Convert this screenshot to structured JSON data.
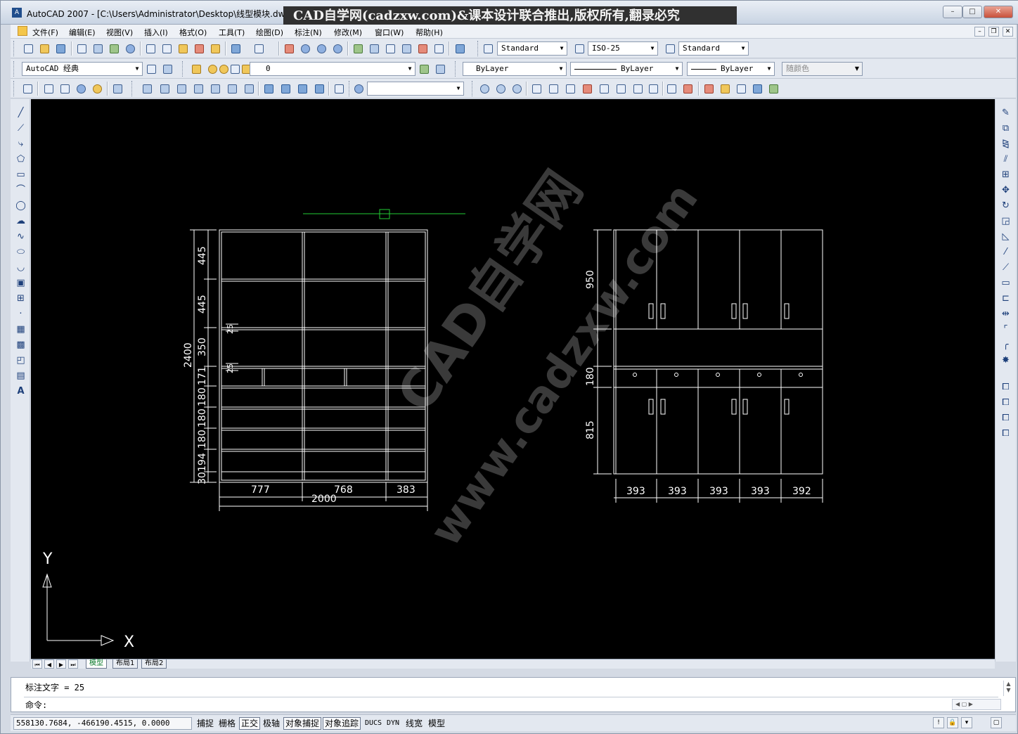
{
  "window": {
    "title": "AutoCAD 2007 - [C:\\Users\\Administrator\\Desktop\\线型模块.dwg]",
    "banner": "CAD自学网(cadzxw.com)&课本设计联合推出,版权所有,翻录必究",
    "min": "–",
    "max": "□",
    "close": "✕"
  },
  "menu": {
    "items": [
      "文件(F)",
      "编辑(E)",
      "视图(V)",
      "插入(I)",
      "格式(O)",
      "工具(T)",
      "绘图(D)",
      "标注(N)",
      "修改(M)",
      "窗口(W)",
      "帮助(H)"
    ],
    "doc_min": "–",
    "doc_restore": "❐",
    "doc_close": "✕"
  },
  "styles": {
    "text_style": "Standard",
    "dim_style": "ISO-25",
    "table_style": "Standard"
  },
  "workspace": {
    "name": "AutoCAD 经典"
  },
  "layer": {
    "current": "0",
    "color": "ByLayer",
    "linetype": "ByLayer",
    "lineweight": "ByLayer",
    "plotstyle": "随颜色"
  },
  "view": {
    "named_view": ""
  },
  "tabs": {
    "model": "模型",
    "layout1": "布局1",
    "layout2": "布局2"
  },
  "command": {
    "history": "标注文字 = 25",
    "prompt": "命令:"
  },
  "status": {
    "coords": "558130.7684, -466190.4515, 0.0000",
    "buttons": [
      "捕捉",
      "栅格",
      "正交",
      "极轴",
      "对象捕捉",
      "对象追踪",
      "DUCS",
      "DYN",
      "线宽",
      "模型"
    ],
    "on": [
      false,
      false,
      true,
      false,
      true,
      true,
      false,
      false,
      false,
      false
    ]
  },
  "colors": {
    "canvas": "#000000",
    "drawing": "#ffffff",
    "grip": "#22cc33",
    "watermark": "#3a3a3a"
  },
  "drawing": {
    "watermark_cn": "CAD自学网",
    "watermark_url": "www.cadzxw.com",
    "ucs": {
      "x": "X",
      "y": "Y"
    },
    "left": {
      "vertical_dims": [
        "445",
        "445",
        "350",
        "171",
        "180",
        "180",
        "180",
        "194",
        "30"
      ],
      "overall": "2400",
      "small_dims": [
        "25",
        "25"
      ],
      "horizontal_dims": [
        "777",
        "768",
        "383"
      ],
      "total_width": "2000"
    },
    "right": {
      "vertical_dims": [
        "950",
        "180",
        "815"
      ],
      "horizontal_dims": [
        "393",
        "393",
        "393",
        "393",
        "392"
      ]
    }
  }
}
